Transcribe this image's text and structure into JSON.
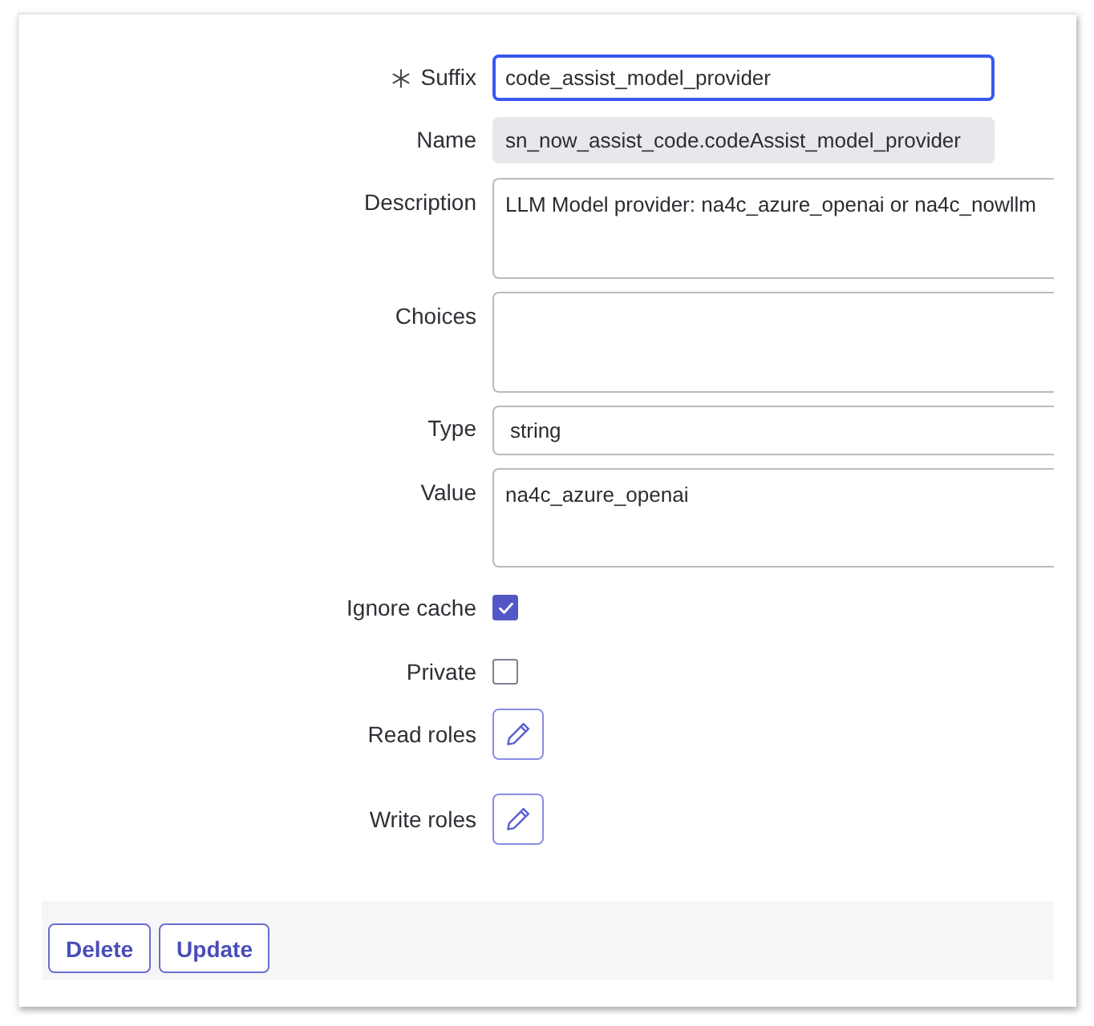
{
  "form": {
    "fields": [
      {
        "kind": "short",
        "label": "Suffix",
        "required": true,
        "focused": true,
        "value": "code_assist_model_provider"
      },
      {
        "kind": "readonly",
        "label": "Name",
        "required": false,
        "focused": false,
        "value": "sn_now_assist_code.codeAssist_model_provider"
      },
      {
        "kind": "textarea",
        "label": "Description",
        "required": false,
        "focused": false,
        "value": "LLM Model provider: na4c_azure_openai or na4c_nowllm"
      },
      {
        "kind": "textarea",
        "label": "Choices",
        "required": false,
        "focused": false
      },
      {
        "kind": "text",
        "label": "Type",
        "required": false,
        "focused": false,
        "value": "string"
      },
      {
        "kind": "textarea",
        "label": "Value",
        "required": false,
        "focused": false,
        "value": "na4c_azure_openai"
      },
      {
        "kind": "checkbox",
        "label": "Ignore cache",
        "required": false,
        "focused": false,
        "checked": true
      },
      {
        "kind": "checkbox",
        "label": "Private",
        "required": false,
        "focused": false,
        "checked": false
      },
      {
        "kind": "roles",
        "label": "Read roles",
        "required": false,
        "focused": false
      },
      {
        "kind": "roles",
        "label": "Write roles",
        "required": false,
        "focused": false
      }
    ]
  },
  "buttons": [
    {
      "label": "Delete"
    },
    {
      "label": "Update"
    }
  ]
}
